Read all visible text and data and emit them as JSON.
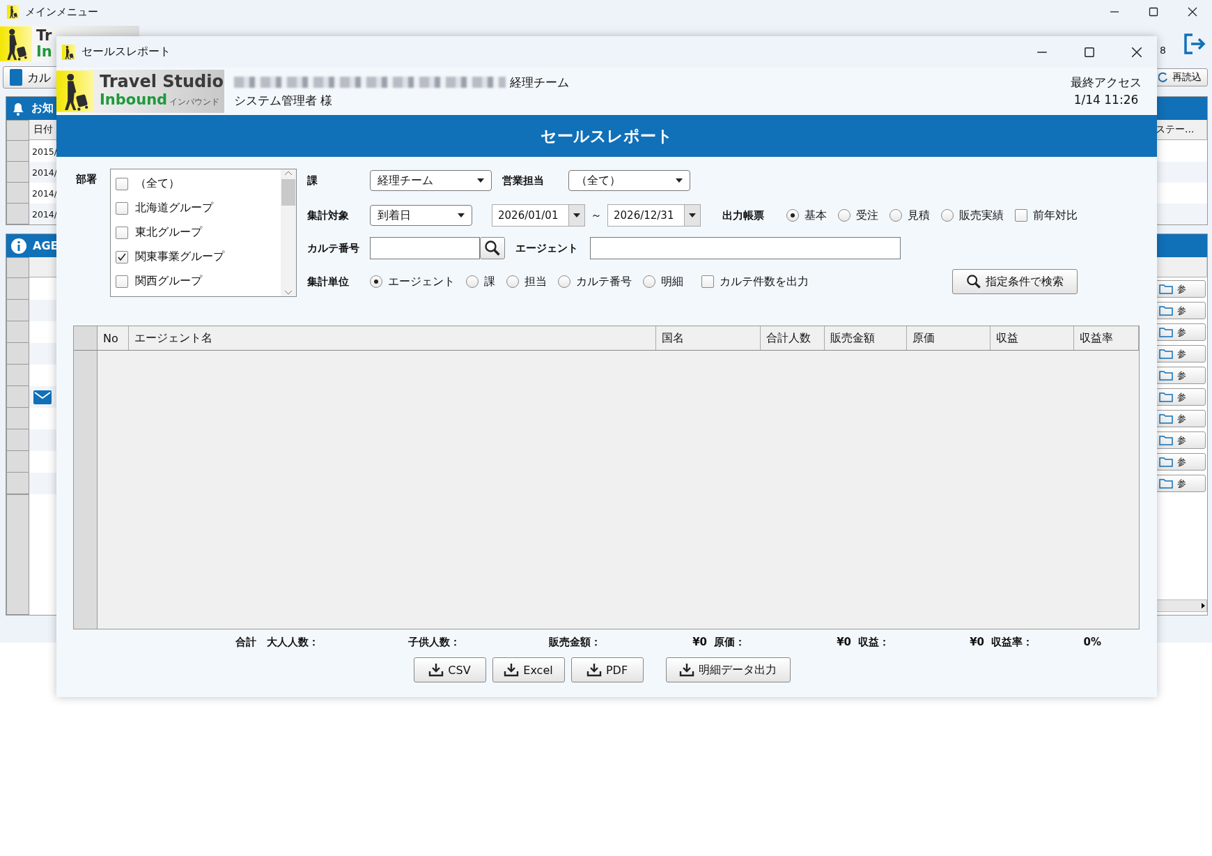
{
  "main_window": {
    "title": "メインメニュー",
    "logo_texts": [
      "Tr",
      "In"
    ],
    "last_access_fragment": "8",
    "card_button": "カル",
    "reload_button": "再読込",
    "notice_panel": {
      "title": "お知",
      "date_column": "日付",
      "status_column": "ステー...",
      "rows": [
        "2015/",
        "2014/",
        "2014/",
        "2014/"
      ]
    },
    "agent_panel": {
      "title": "AGE",
      "rows": [
        {
          "mail": false,
          "button": "参"
        },
        {
          "mail": false,
          "button": "参"
        },
        {
          "mail": false,
          "button": "参"
        },
        {
          "mail": false,
          "button": "参"
        },
        {
          "mail": false,
          "button": "参"
        },
        {
          "mail": true,
          "button": "参"
        },
        {
          "mail": false,
          "button": "参"
        },
        {
          "mail": false,
          "button": "参"
        },
        {
          "mail": false,
          "button": "参"
        },
        {
          "mail": false,
          "button": "参"
        }
      ]
    }
  },
  "dialog": {
    "title": "セールスレポート",
    "logo": {
      "line1": "Travel Studio",
      "line2": "Inbound",
      "tagline": "インバウンド"
    },
    "user": {
      "team": "経理チーム",
      "name": "システム管理者 様"
    },
    "last_access": {
      "label": "最終アクセス",
      "time": "1/14 11:26"
    },
    "banner": "セールスレポート",
    "form": {
      "department": {
        "label": "部署",
        "items": [
          {
            "label": "（全て）",
            "checked": false
          },
          {
            "label": "北海道グループ",
            "checked": false
          },
          {
            "label": "東北グループ",
            "checked": false
          },
          {
            "label": "関東事業グループ",
            "checked": true
          },
          {
            "label": "関西グループ",
            "checked": false
          }
        ]
      },
      "section": {
        "label": "課",
        "value": "経理チーム"
      },
      "sales_rep": {
        "label": "営業担当",
        "value": "（全て）"
      },
      "target": {
        "label": "集計対象",
        "value": "到着日",
        "date_from": "2026/01/01",
        "separator": "～",
        "date_to": "2026/12/31"
      },
      "output_form": {
        "label": "出力帳票",
        "options": [
          {
            "label": "基本",
            "selected": true
          },
          {
            "label": "受注",
            "selected": false
          },
          {
            "label": "見積",
            "selected": false
          },
          {
            "label": "販売実績",
            "selected": false
          }
        ],
        "compare": {
          "label": "前年対比",
          "checked": false
        }
      },
      "karte": {
        "label": "カルテ番号"
      },
      "agent": {
        "label": "エージェント"
      },
      "unit": {
        "label": "集計単位",
        "options": [
          {
            "label": "エージェント",
            "selected": true
          },
          {
            "label": "課",
            "selected": false
          },
          {
            "label": "担当",
            "selected": false
          },
          {
            "label": "カルテ番号",
            "selected": false
          },
          {
            "label": "明細",
            "selected": false
          }
        ],
        "count_checkbox": {
          "label": "カルテ件数を出力",
          "checked": false
        }
      },
      "search_button": "指定条件で検索"
    },
    "table": {
      "columns": [
        "No",
        "エージェント名",
        "国名",
        "合計人数",
        "販売金額",
        "原価",
        "収益",
        "収益率"
      ]
    },
    "totals": {
      "label": "合計",
      "items": [
        {
          "label": "大人人数："
        },
        {
          "label": "子供人数："
        },
        {
          "label": "販売金額：",
          "value": "¥0"
        },
        {
          "label": "原価：",
          "value": "¥0"
        },
        {
          "label": "収益：",
          "value": "¥0"
        },
        {
          "label": "収益率：",
          "value": "0%"
        }
      ]
    },
    "buttons": [
      "CSV",
      "Excel",
      "PDF",
      "明細データ出力"
    ]
  }
}
